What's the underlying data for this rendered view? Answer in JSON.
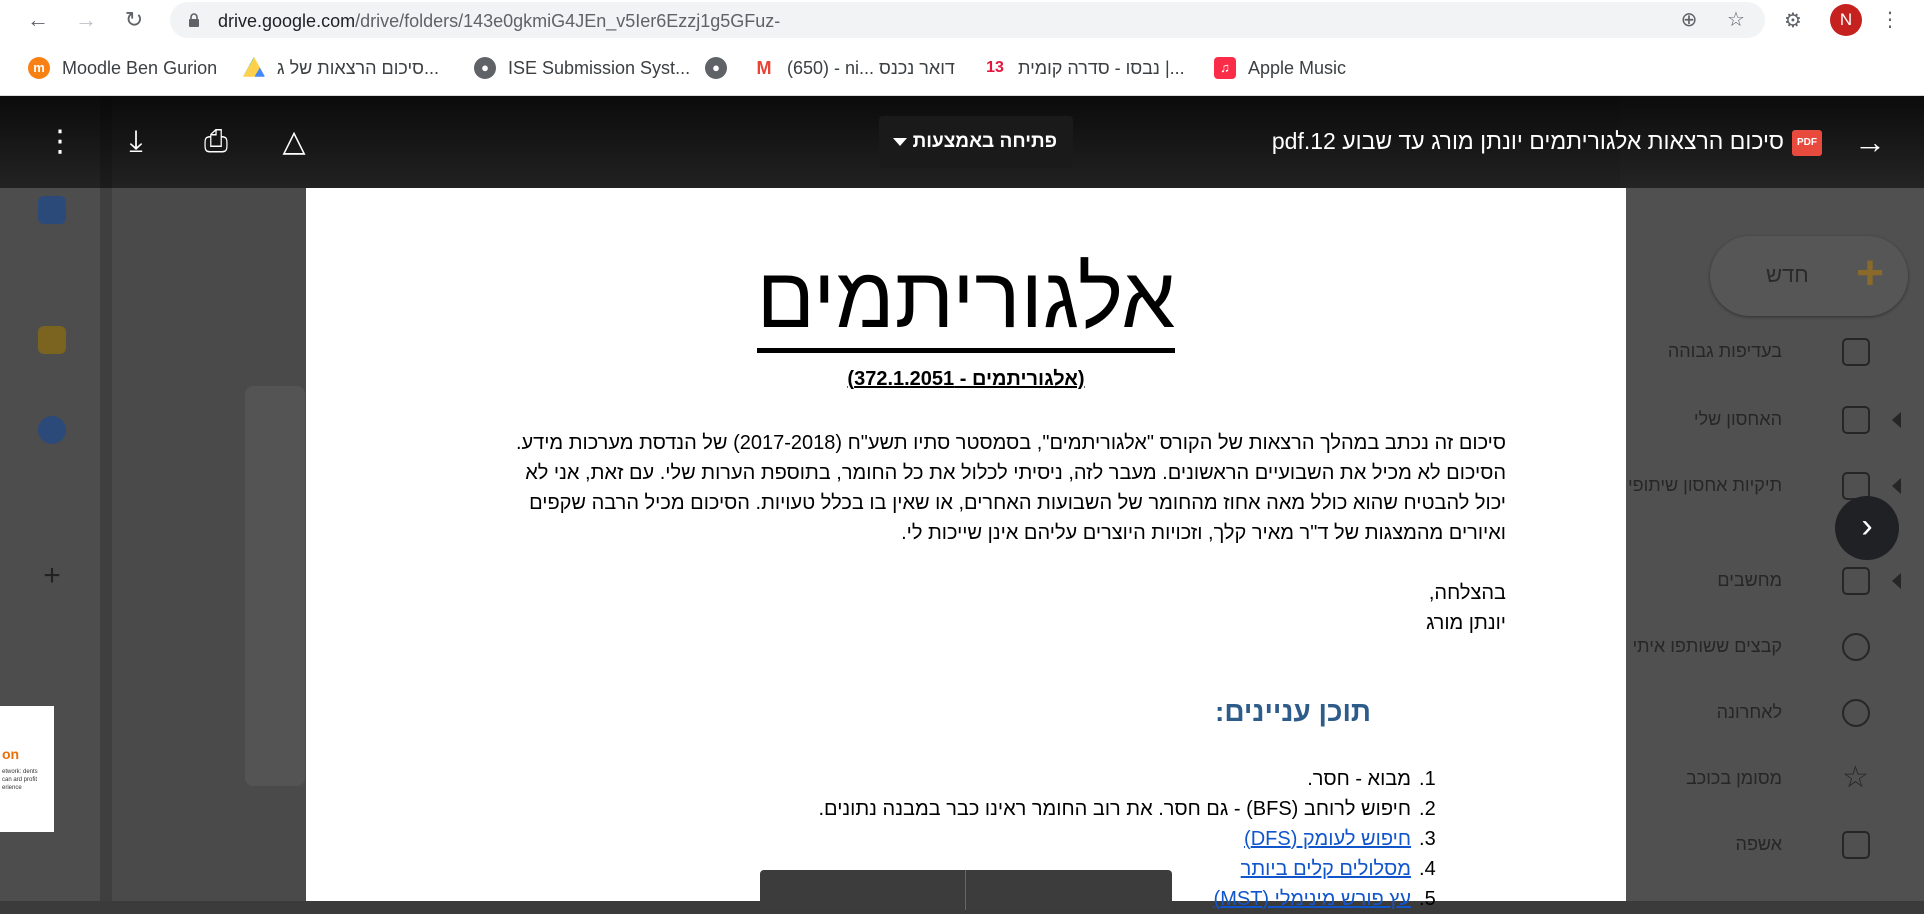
{
  "browser": {
    "url_host": "drive.google.com",
    "url_path": "/drive/folders/143e0gkmiG4JEn_v5Ier6Ezzj1g5GFuz-",
    "profile_initial": "N",
    "bookmarks": [
      {
        "label": "Moodle Ben Gurion",
        "icon": "moodle-icon",
        "color": "#f98012"
      },
      {
        "label": "סיכום הרצאות של ג...",
        "icon": "drive-icon",
        "color": "#1fa463"
      },
      {
        "label": "ISE Submission Syst...",
        "icon": "globe-icon",
        "color": "#5f6368"
      },
      {
        "label": "",
        "icon": "globe-icon",
        "color": "#5f6368"
      },
      {
        "label": "(650) - ni... דואר נכנס",
        "icon": "gmail-icon",
        "color": "#ea4335"
      },
      {
        "label": "נבסו - סדרה קומית |...",
        "icon": "channel13-icon",
        "color": "#e3173e"
      },
      {
        "label": "Apple Music",
        "icon": "apple-music-icon",
        "color": "#fa2d48"
      }
    ]
  },
  "drive_background": {
    "new_button": "חדש",
    "nav": [
      {
        "label": "בעדיפות גבוהה",
        "icon": "priority-icon"
      },
      {
        "label": "האחסון שלי",
        "icon": "my-drive-icon"
      },
      {
        "label": "תיקיות אחסון שיתופי",
        "icon": "shared-drives-icon"
      },
      {
        "label": "מחשבים",
        "icon": "computers-icon"
      },
      {
        "label": "קבצים ששותפו איתי",
        "icon": "shared-with-me-icon"
      },
      {
        "label": "לאחרונה",
        "icon": "recent-icon"
      },
      {
        "label": "מסומן בכוכב",
        "icon": "starred-icon"
      },
      {
        "label": "אשפה",
        "icon": "trash-icon"
      }
    ]
  },
  "viewer": {
    "file_title": "סיכום הרצאות אלגוריתמים יונתן מורג עד שבוע 12.pdf",
    "open_with": "פתיחה באמצעות",
    "pdf_badge": "PDF"
  },
  "document": {
    "title": "אלגוריתמים",
    "subtitle": "(אלגוריתמים - 372.1.2051)",
    "intro_lines": [
      "סיכום זה נכתב במהלך הרצאות של הקורס \"אלגוריתמים\", בסמסטר סתיו תשע\"ח (2017-2018) של הנדסת מערכות מידע.",
      "הסיכום לא מכיל את השבועיים הראשונים. מעבר לזה, ניסיתי לכלול את כל החומר, בתוספת הערות שלי. עם זאת, אני לא",
      "יכול להבטיח שהוא כולל מאה אחוז מהחומר של השבועות האחרים, או שאין בו בכלל טעויות. הסיכום מכיל הרבה שקפים",
      "ואיורים מהמצגות של ד\"ר מאיר קלך, וזכויות היוצרים עליהם אינן שייכות לי."
    ],
    "sign_off": "בהצלחה,",
    "author": "יונתן מורג",
    "toc_title": "תוכן עניינים:",
    "toc": [
      {
        "num": "1.",
        "text": "מבוא - חסר.",
        "link": false
      },
      {
        "num": "2.",
        "text": "חיפוש לרוחב (BFS) - גם חסר. את רוב החומר ראינו כבר במבנה נתונים.",
        "link": false
      },
      {
        "num": "3.",
        "text": "חיפוש לעומק (DFS)",
        "link": true
      },
      {
        "num": "4.",
        "text": "מסלולים קלים ביותר",
        "link": true
      },
      {
        "num": "5.",
        "text": "עץ פורש מינימלי (MST)",
        "link": true
      }
    ]
  }
}
